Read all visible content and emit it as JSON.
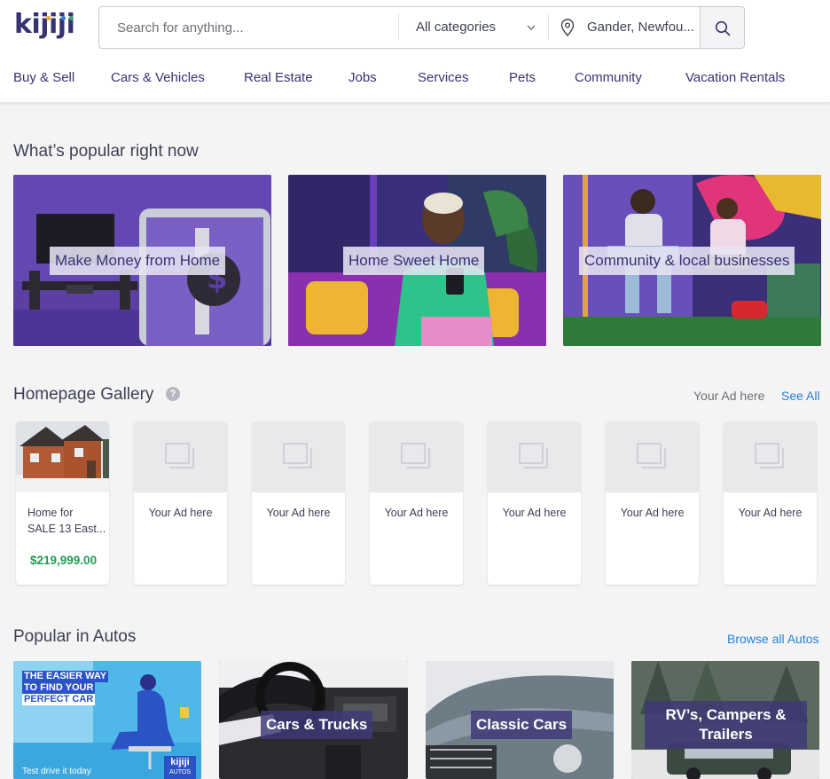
{
  "header": {
    "logo_text": "kijiji",
    "search": {
      "placeholder": "Search for anything...",
      "value": ""
    },
    "category_select": "All categories",
    "location": "Gander, Newfou...",
    "search_button_icon": "search-icon"
  },
  "nav": {
    "items": [
      "Buy & Sell",
      "Cars & Vehicles",
      "Real Estate",
      "Jobs",
      "Services",
      "Pets",
      "Community",
      "Vacation Rentals"
    ]
  },
  "popular": {
    "title": "What’s popular right now",
    "tiles": [
      {
        "label": "Make Money from Home"
      },
      {
        "label": "Home Sweet Home"
      },
      {
        "label": "Community & local businesses"
      }
    ]
  },
  "gallery": {
    "title": "Homepage Gallery",
    "help_icon": "?",
    "your_ad_link": "Your Ad here",
    "see_all": "See All",
    "listing": {
      "title_line1": "Home for",
      "title_line2": "SALE 13 East...",
      "price": "$219,999.00"
    },
    "placeholders": [
      "Your Ad here",
      "Your Ad here",
      "Your Ad here",
      "Your Ad here",
      "Your Ad here",
      "Your Ad here"
    ]
  },
  "autos": {
    "title": "Popular in Autos",
    "browse_all": "Browse all Autos",
    "promo": {
      "line1": "THE EASIER WAY",
      "line2": "TO FIND YOUR",
      "line3": "PERFECT CAR",
      "footer": "Test drive it today",
      "brand": "kijiji",
      "brand_sub": "AUTOS"
    },
    "tiles": [
      {
        "label": "Cars & Trucks"
      },
      {
        "label": "Classic Cars"
      },
      {
        "label_line1": "RV’s, Campers &",
        "label_line2": "Trailers"
      }
    ]
  },
  "colors": {
    "brand": "#373373",
    "link": "#2681db",
    "price": "#1f9d55",
    "background": "#f4f4f5"
  }
}
